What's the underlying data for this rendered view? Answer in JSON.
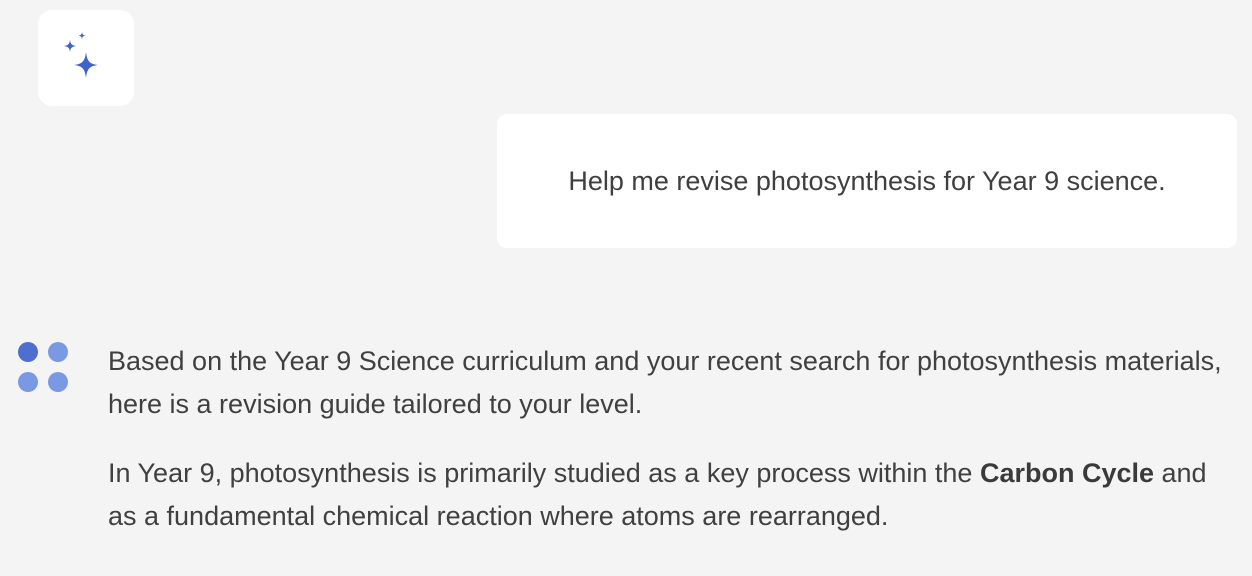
{
  "toolbar": {
    "assistant_icon": "sparkle-icon",
    "accent_color": "#3f63c9"
  },
  "conversation": {
    "user_message": "Help me revise photosynthesis for Year 9 science.",
    "assistant": {
      "avatar_icon": "dots-avatar-icon",
      "avatar_colors": [
        "#4e6fd0",
        "#7b98e3"
      ],
      "paragraph_1": "Based on the Year 9 Science curriculum and your recent search for photosynthesis materials, here is a revision guide tailored to your level.",
      "paragraph_2_before": "In Year 9, photosynthesis is primarily studied as a key process within the ",
      "paragraph_2_bold": "Carbon Cycle",
      "paragraph_2_after": " and as a fundamental chemical reaction where atoms are rearranged."
    }
  }
}
